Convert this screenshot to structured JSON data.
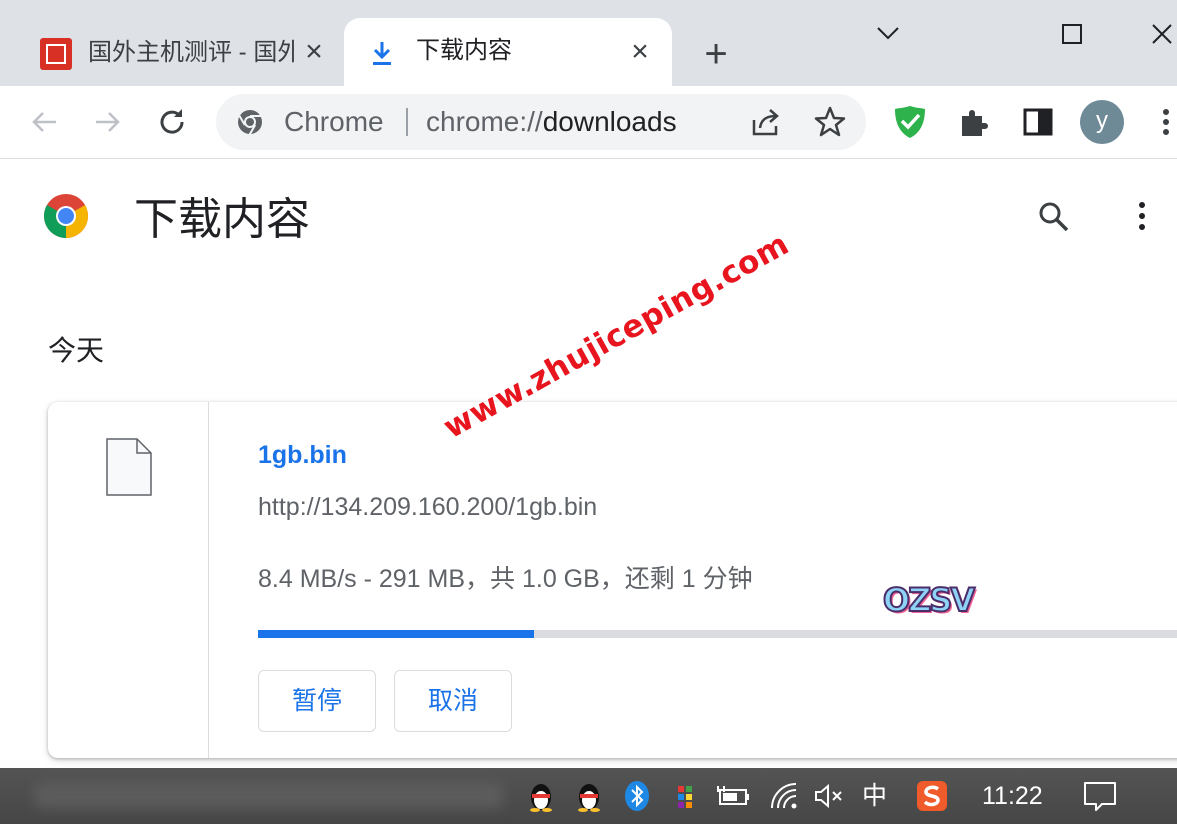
{
  "browser": {
    "tabs": [
      {
        "title": "国外主机测评 - 国外",
        "active": false
      },
      {
        "title": "下载内容",
        "active": true
      }
    ],
    "omnibox": {
      "site_label": "Chrome",
      "url_scheme": "chrome://",
      "url_path": "downloads"
    },
    "profile_initial": "y"
  },
  "page": {
    "title": "下载内容",
    "section_label": "今天",
    "download": {
      "file_name": "1gb.bin",
      "url": "http://134.209.160.200/1gb.bin",
      "status": "8.4 MB/s - 291 MB，共 1.0 GB，还剩 1 分钟",
      "progress_fraction": 0.291,
      "pause_label": "暂停",
      "cancel_label": "取消"
    }
  },
  "overlay": {
    "watermark_text": "www.zhujiceping.com",
    "sticker_text": "OZSV"
  },
  "taskbar": {
    "ime_label": "中",
    "clock": "11:22"
  },
  "colors": {
    "accent": "#1a73e8",
    "tabstrip": "#dee1e6",
    "watermark": "#e8141e",
    "adguard": "#2eb24b"
  }
}
